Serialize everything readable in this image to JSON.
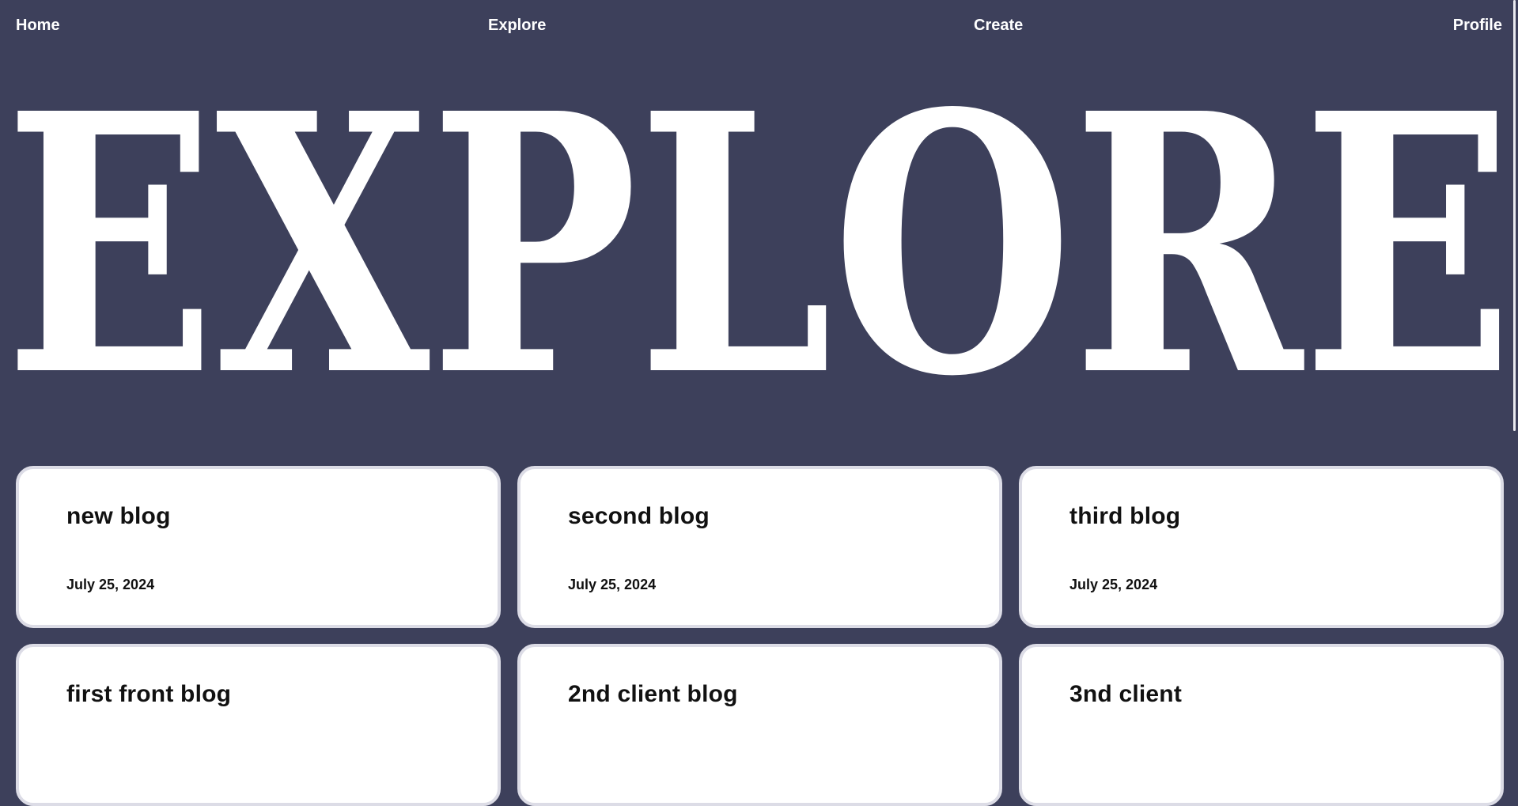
{
  "nav": {
    "home": "Home",
    "explore": "Explore",
    "create": "Create",
    "profile": "Profile"
  },
  "hero": {
    "title": "EXPLORE"
  },
  "colors": {
    "background": "#3d405b",
    "card": "#ffffff",
    "text_light": "#ffffff",
    "text_dark": "#111111"
  },
  "posts": [
    {
      "title": "new blog",
      "date": "July 25, 2024"
    },
    {
      "title": "second blog",
      "date": "July 25, 2024"
    },
    {
      "title": "third blog",
      "date": "July 25, 2024"
    },
    {
      "title": "first front blog",
      "date": ""
    },
    {
      "title": "2nd client blog",
      "date": ""
    },
    {
      "title": "3nd client",
      "date": ""
    }
  ]
}
